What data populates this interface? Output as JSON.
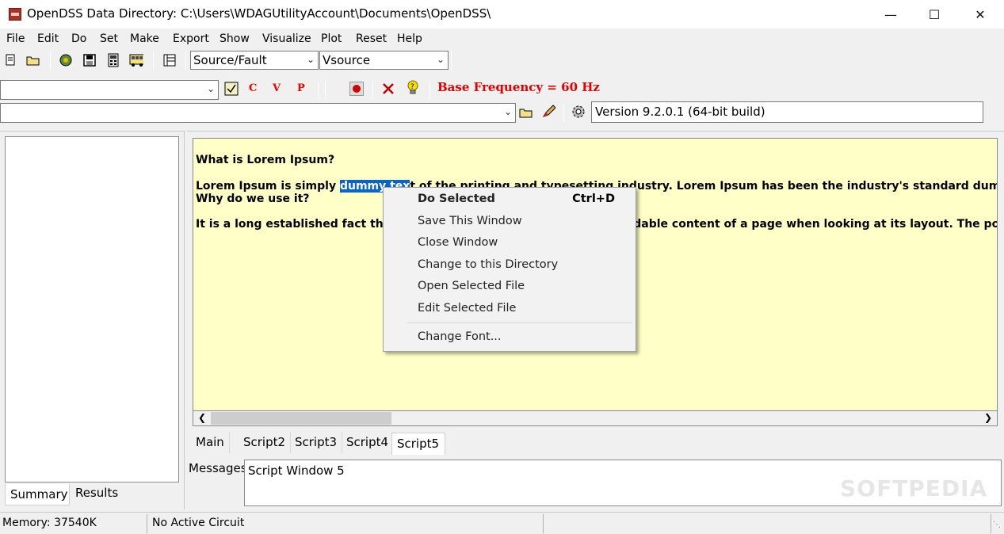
{
  "window": {
    "title": "OpenDSS Data Directory: C:\\Users\\WDAGUtilityAccount\\Documents\\OpenDSS\\",
    "minimize": "—",
    "maximize": "☐",
    "close": "✕"
  },
  "menu": [
    "File",
    "Edit",
    "Do",
    "Set",
    "Make",
    "Export",
    "Show",
    "Visualize",
    "Plot",
    "Reset",
    "Help"
  ],
  "toolbar1": {
    "combo_class": "Source/Fault",
    "combo_element": "Vsource"
  },
  "toolbar2": {
    "combo_left": "",
    "btn_c": "C",
    "btn_v": "V",
    "btn_p": "P",
    "base_frequency": "Base Frequency = 60 Hz"
  },
  "toolbar3": {
    "combo_path": "",
    "version": "Version 9.2.0.1 (64-bit build)"
  },
  "editor": {
    "line1": "What is Lorem Ipsum?",
    "line2_before": "Lorem Ipsum is simply ",
    "line2_selected": "dummy tex",
    "line2_after": "t of the printing and typesetting industry. Lorem Ipsum has been the industry's standard dummy text ever since",
    "line3": "Why do we use it?",
    "line4": "It is a long established fact that a reader will be distracted by the readable content of a page when looking at its layout. The point of using Lo"
  },
  "context_menu": {
    "do_selected": "Do Selected",
    "do_selected_shortcut": "Ctrl+D",
    "save_window": "Save This Window",
    "close_window": "Close Window",
    "change_dir": "Change to this Directory",
    "open_file": "Open Selected File",
    "edit_file": "Edit Selected File",
    "change_font": "Change Font..."
  },
  "script_tabs": [
    "Main",
    "Script2",
    "Script3",
    "Script4",
    "Script5"
  ],
  "active_script_tab": "Script5",
  "left_tabs": [
    "Summary",
    "Results"
  ],
  "messages": {
    "label": "Messages",
    "text": "Script Window 5"
  },
  "status": {
    "memory": "Memory: 37540K",
    "circuit": "No Active Circuit"
  },
  "watermark": "SOFTPEDIA",
  "colors": {
    "editor_bg": "#ffffc8",
    "selection": "#0a64c8",
    "base_freq": "#e00000"
  }
}
